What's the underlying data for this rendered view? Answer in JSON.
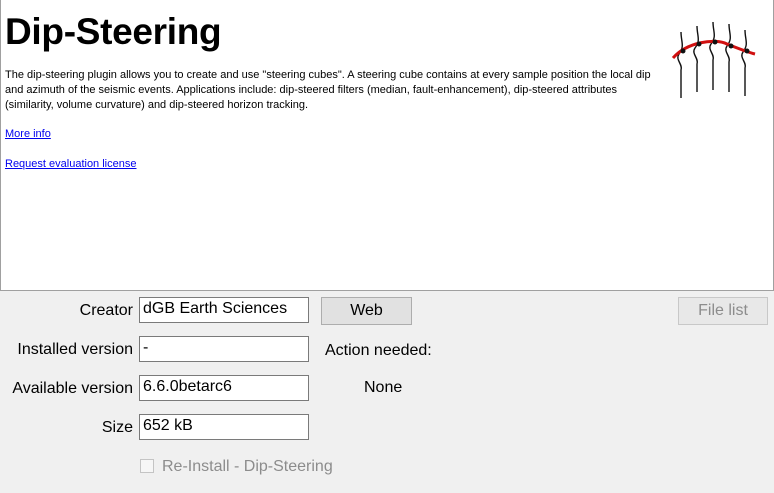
{
  "plugin": {
    "title": "Dip-Steering",
    "description": "The dip-steering plugin allows you to create and use \"steering cubes\". A steering cube contains at every sample position the local dip and azimuth of the seismic events. Applications include: dip-steered filters (median, fault-enhancement), dip-steered attributes (similarity, volume curvature) and dip-steered horizon tracking.",
    "more_info_link": "More info",
    "license_link": "Request evaluation license",
    "logo_icon": "dip-steering-logo-icon"
  },
  "details": {
    "creator_label": "Creator",
    "creator_value": "dGB Earth Sciences",
    "installed_label": "Installed version",
    "installed_value": "-",
    "available_label": "Available version",
    "available_value": "6.6.0betarc6",
    "size_label": "Size",
    "size_value": "652 kB"
  },
  "buttons": {
    "web": "Web",
    "file_list": "File list"
  },
  "action": {
    "label": "Action needed:",
    "value": "None"
  },
  "reinstall": {
    "label": "Re-Install - Dip-Steering",
    "checked": false
  }
}
